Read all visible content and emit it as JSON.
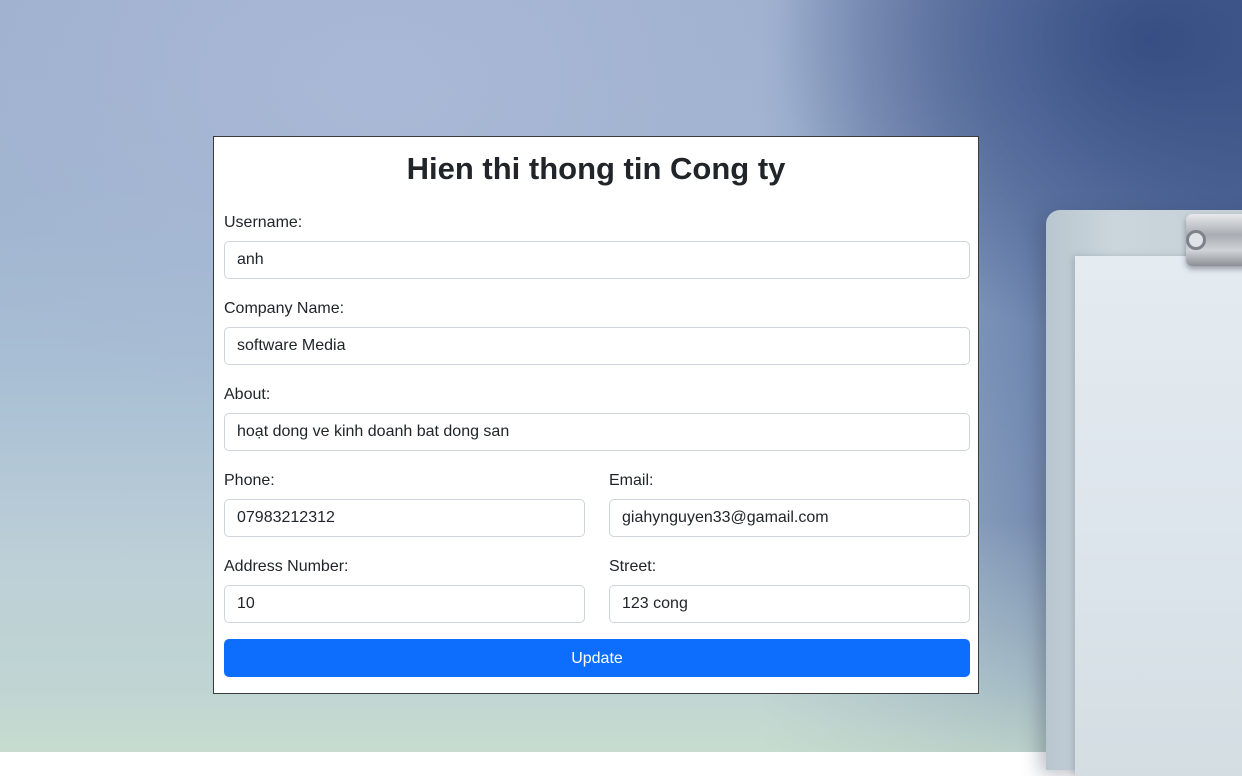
{
  "form": {
    "title": "Hien thi thong tin Cong ty",
    "username": {
      "label": "Username:",
      "value": "anh"
    },
    "company_name": {
      "label": "Company Name:",
      "value": "software Media"
    },
    "about": {
      "label": "About:",
      "value": "hoạt dong ve kinh doanh bat dong san"
    },
    "phone": {
      "label": "Phone:",
      "value": "07983212312"
    },
    "email": {
      "label": "Email:",
      "value": "giahynguyen33@gamail.com"
    },
    "address_number": {
      "label": "Address Number:",
      "value": "10"
    },
    "street": {
      "label": "Street:",
      "value": "123 cong"
    },
    "submit_label": "Update"
  },
  "colors": {
    "primary_button": "#0d6efd",
    "input_border": "#ced4da",
    "text": "#212529"
  }
}
